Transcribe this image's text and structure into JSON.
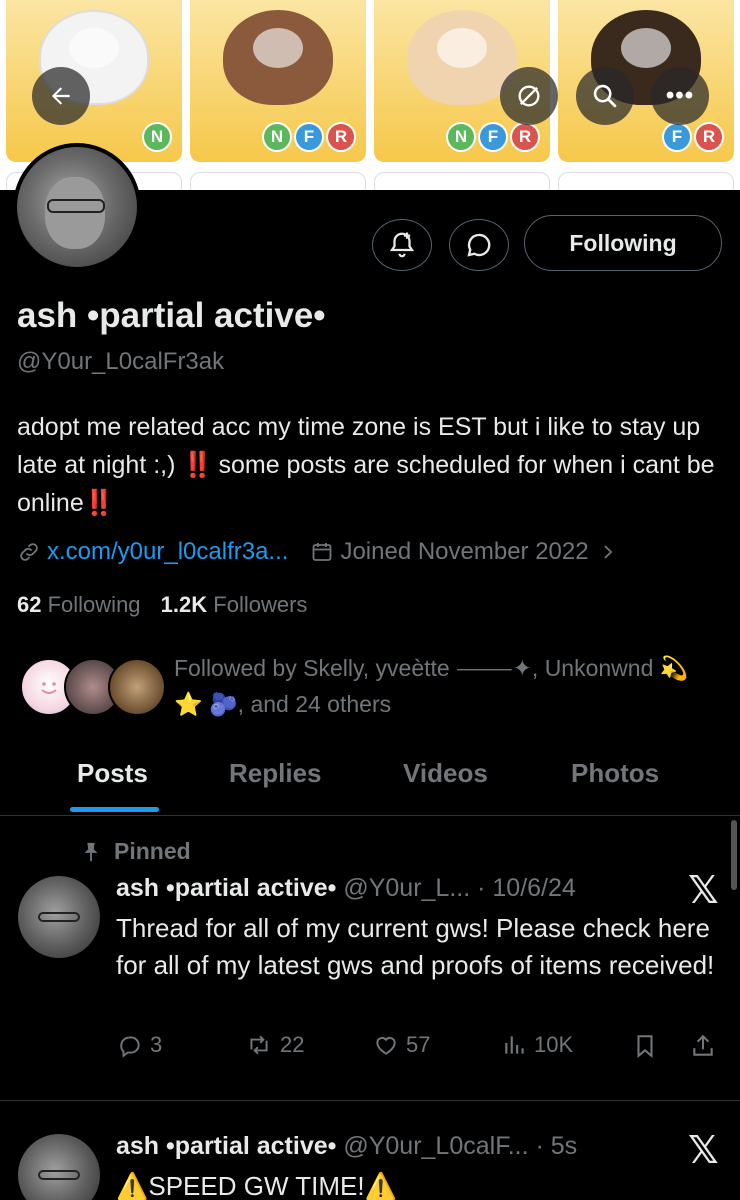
{
  "banner": {
    "tiles": [
      {
        "badges": [
          "N"
        ]
      },
      {
        "badges": [
          "N",
          "F",
          "R"
        ]
      },
      {
        "badges": [
          "N",
          "F",
          "R"
        ]
      },
      {
        "badges": [
          "F",
          "R"
        ]
      }
    ]
  },
  "header_buttons": {
    "back": "back-arrow-icon",
    "mute": "mute-icon",
    "search": "search-icon",
    "more": "•••"
  },
  "profile": {
    "name": "ash •partial active•",
    "handle": "@Y0ur_L0calFr3ak",
    "following_button": "Following",
    "bio_part1": "adopt me related acc my time zone is EST but i like to stay up late at night :,) ",
    "bio_mark1": "‼️",
    "bio_part2": " some posts are scheduled for when i cant be online",
    "bio_mark2": "‼️",
    "link": "x.com/y0ur_l0calfr3a...",
    "joined": "Joined November 2022",
    "following_count": "62",
    "following_label": "Following",
    "followers_count": "1.2K",
    "followers_label": "Followers",
    "followed_by_line1": "Followed by Skelly, yveètte ⸻✦, Unkonwnd 💫",
    "followed_by_line2": "⭐ 🫐, and 24 others"
  },
  "tabs": [
    "Posts",
    "Replies",
    "Videos",
    "Photos"
  ],
  "pinned_label": "Pinned",
  "posts": [
    {
      "name": "ash •partial active•",
      "handle_date": "@Y0ur_L... · 10/6/24",
      "text": "Thread for all of my current gws! Please check here for all of my latest gws and proofs of items received!",
      "replies": "3",
      "retweets": "22",
      "likes": "57",
      "views": "10K"
    },
    {
      "name": "ash •partial active•",
      "handle_date": "@Y0ur_L0calF... · 5s",
      "text": "⚠️SPEED GW TIME!⚠️"
    }
  ],
  "colors": {
    "accent": "#1d9bf0",
    "muted": "#71767b",
    "alert": "#f4212e"
  }
}
